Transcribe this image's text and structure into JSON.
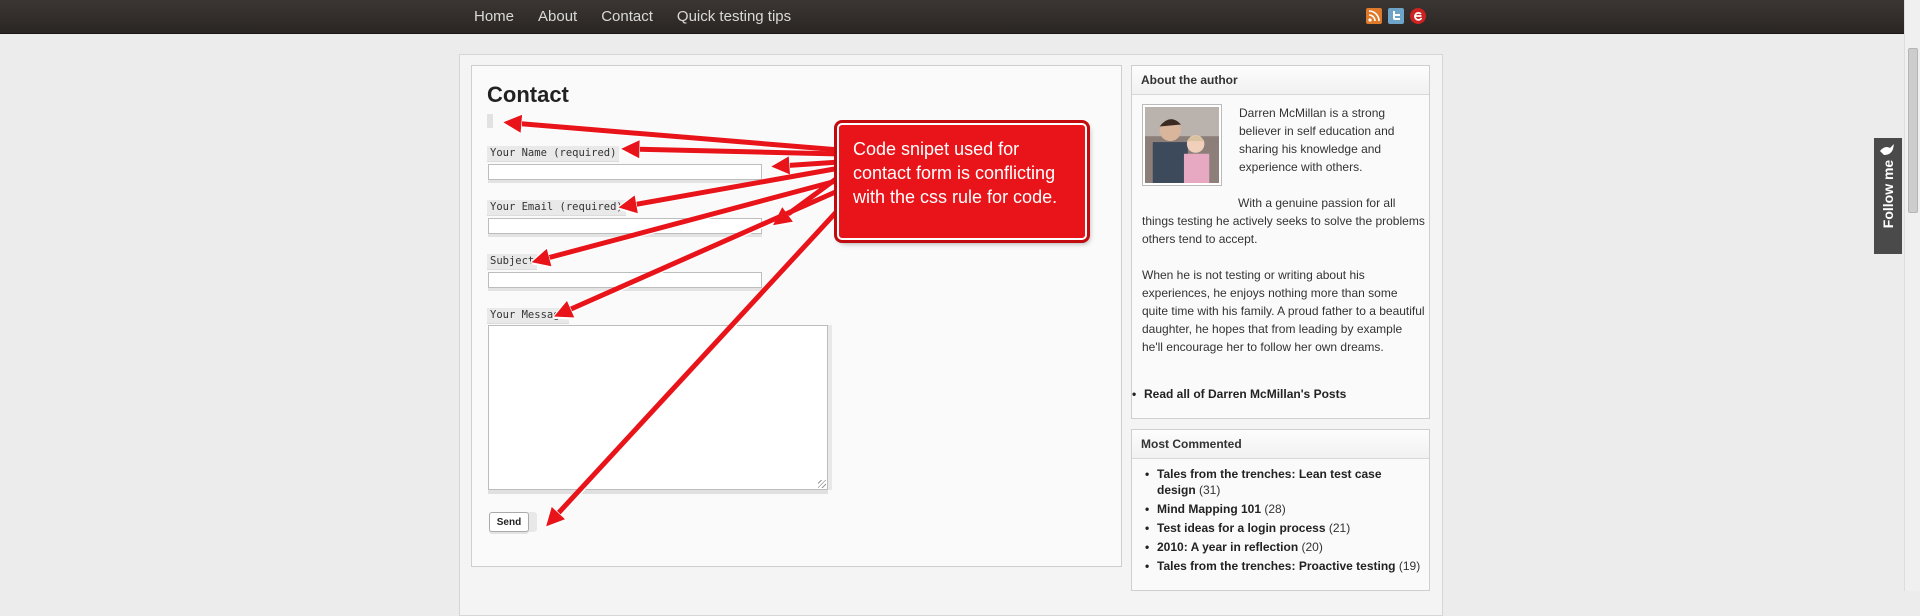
{
  "nav": {
    "items": [
      "Home",
      "About",
      "Contact",
      "Quick testing tips"
    ],
    "social_icons": [
      "rss-icon",
      "twitter-icon",
      "email-subscribe-icon"
    ]
  },
  "page": {
    "title": "Contact"
  },
  "form": {
    "name_label": "Your Name (required)",
    "email_label": "Your Email (required)",
    "subject_label": "Subject",
    "message_label": "Your Message",
    "send_label": "Send"
  },
  "annotation": {
    "text": "Code snipet used for contact form is conflicting with the css rule for code."
  },
  "sidebar": {
    "author": {
      "heading": "About the author",
      "p1": "Darren McMillan is a strong believer in self education and sharing his knowledge and experience with others.",
      "p2": "With a genuine passion for all things testing he actively seeks to solve the problems others tend to accept.",
      "p3": "When he is not testing or writing about his experiences, he enjoys nothing more than some quite time with his family. A proud father to a beautiful daughter, he hopes that from leading by example he'll encourage her to follow her own dreams.",
      "link": "Read all of Darren McMillan's Posts"
    },
    "most_commented": {
      "heading": "Most Commented",
      "items": [
        {
          "title": "Tales from the trenches: Lean test case design",
          "count": "(31)"
        },
        {
          "title": "Mind Mapping 101",
          "count": "(28)"
        },
        {
          "title": "Test ideas for a login process",
          "count": "(21)"
        },
        {
          "title": "2010: A year in reflection",
          "count": "(20)"
        },
        {
          "title": "Tales from the trenches: Proactive testing",
          "count": "(19)"
        }
      ]
    }
  },
  "follow_tab": {
    "label": "Follow me"
  },
  "colors": {
    "topbar": "#2f2b28",
    "annotation_red": "#e8141a",
    "rss": "#e07a2b",
    "twitter": "#6fa4c9",
    "email": "#cc2222"
  }
}
